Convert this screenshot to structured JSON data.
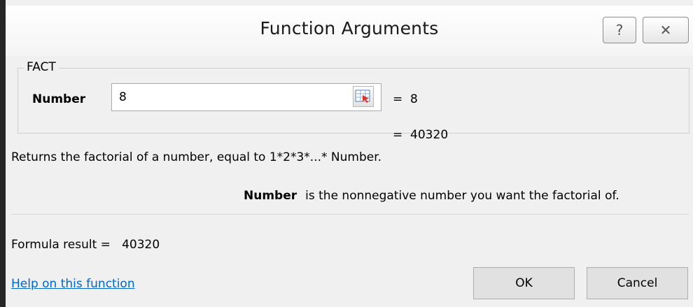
{
  "window": {
    "title": "Function Arguments",
    "help_glyph": "?",
    "close_glyph": "✕"
  },
  "function": {
    "name": "FACT",
    "argument": {
      "label": "Number",
      "value": "8",
      "evaluated": "=  8"
    },
    "result_preview": "=  40320",
    "description": "Returns the factorial of a number, equal to 1*2*3*...* Number.",
    "argument_help": {
      "name": "Number",
      "text": "is the nonnegative number you want the factorial of."
    }
  },
  "footer": {
    "formula_result": "Formula result =   40320",
    "help_link": "Help on this function",
    "ok_label": "OK",
    "cancel_label": "Cancel"
  },
  "icons": {
    "range_selector": "collapse-dialog-icon"
  }
}
